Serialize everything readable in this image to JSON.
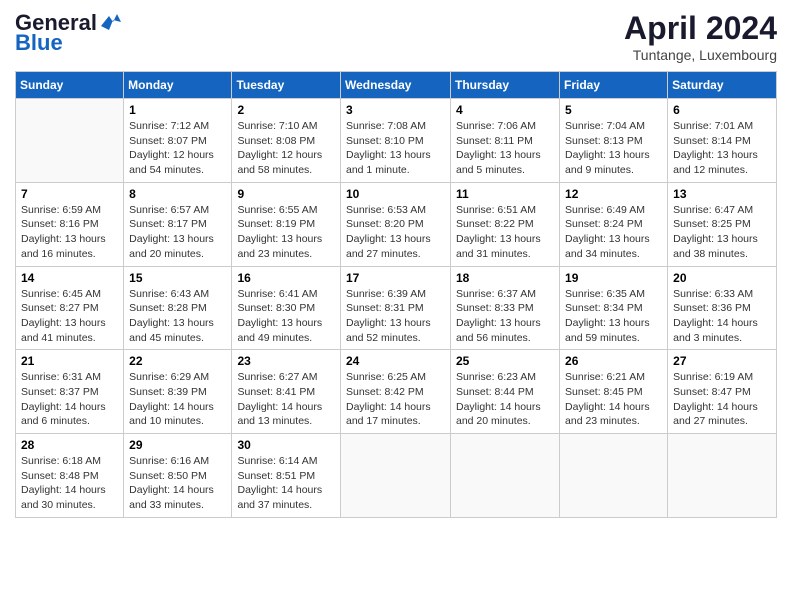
{
  "header": {
    "logo_general": "General",
    "logo_blue": "Blue",
    "month_title": "April 2024",
    "location": "Tuntange, Luxembourg"
  },
  "weekdays": [
    "Sunday",
    "Monday",
    "Tuesday",
    "Wednesday",
    "Thursday",
    "Friday",
    "Saturday"
  ],
  "weeks": [
    [
      {
        "day": "",
        "sunrise": "",
        "sunset": "",
        "daylight": ""
      },
      {
        "day": "1",
        "sunrise": "Sunrise: 7:12 AM",
        "sunset": "Sunset: 8:07 PM",
        "daylight": "Daylight: 12 hours and 54 minutes."
      },
      {
        "day": "2",
        "sunrise": "Sunrise: 7:10 AM",
        "sunset": "Sunset: 8:08 PM",
        "daylight": "Daylight: 12 hours and 58 minutes."
      },
      {
        "day": "3",
        "sunrise": "Sunrise: 7:08 AM",
        "sunset": "Sunset: 8:10 PM",
        "daylight": "Daylight: 13 hours and 1 minute."
      },
      {
        "day": "4",
        "sunrise": "Sunrise: 7:06 AM",
        "sunset": "Sunset: 8:11 PM",
        "daylight": "Daylight: 13 hours and 5 minutes."
      },
      {
        "day": "5",
        "sunrise": "Sunrise: 7:04 AM",
        "sunset": "Sunset: 8:13 PM",
        "daylight": "Daylight: 13 hours and 9 minutes."
      },
      {
        "day": "6",
        "sunrise": "Sunrise: 7:01 AM",
        "sunset": "Sunset: 8:14 PM",
        "daylight": "Daylight: 13 hours and 12 minutes."
      }
    ],
    [
      {
        "day": "7",
        "sunrise": "Sunrise: 6:59 AM",
        "sunset": "Sunset: 8:16 PM",
        "daylight": "Daylight: 13 hours and 16 minutes."
      },
      {
        "day": "8",
        "sunrise": "Sunrise: 6:57 AM",
        "sunset": "Sunset: 8:17 PM",
        "daylight": "Daylight: 13 hours and 20 minutes."
      },
      {
        "day": "9",
        "sunrise": "Sunrise: 6:55 AM",
        "sunset": "Sunset: 8:19 PM",
        "daylight": "Daylight: 13 hours and 23 minutes."
      },
      {
        "day": "10",
        "sunrise": "Sunrise: 6:53 AM",
        "sunset": "Sunset: 8:20 PM",
        "daylight": "Daylight: 13 hours and 27 minutes."
      },
      {
        "day": "11",
        "sunrise": "Sunrise: 6:51 AM",
        "sunset": "Sunset: 8:22 PM",
        "daylight": "Daylight: 13 hours and 31 minutes."
      },
      {
        "day": "12",
        "sunrise": "Sunrise: 6:49 AM",
        "sunset": "Sunset: 8:24 PM",
        "daylight": "Daylight: 13 hours and 34 minutes."
      },
      {
        "day": "13",
        "sunrise": "Sunrise: 6:47 AM",
        "sunset": "Sunset: 8:25 PM",
        "daylight": "Daylight: 13 hours and 38 minutes."
      }
    ],
    [
      {
        "day": "14",
        "sunrise": "Sunrise: 6:45 AM",
        "sunset": "Sunset: 8:27 PM",
        "daylight": "Daylight: 13 hours and 41 minutes."
      },
      {
        "day": "15",
        "sunrise": "Sunrise: 6:43 AM",
        "sunset": "Sunset: 8:28 PM",
        "daylight": "Daylight: 13 hours and 45 minutes."
      },
      {
        "day": "16",
        "sunrise": "Sunrise: 6:41 AM",
        "sunset": "Sunset: 8:30 PM",
        "daylight": "Daylight: 13 hours and 49 minutes."
      },
      {
        "day": "17",
        "sunrise": "Sunrise: 6:39 AM",
        "sunset": "Sunset: 8:31 PM",
        "daylight": "Daylight: 13 hours and 52 minutes."
      },
      {
        "day": "18",
        "sunrise": "Sunrise: 6:37 AM",
        "sunset": "Sunset: 8:33 PM",
        "daylight": "Daylight: 13 hours and 56 minutes."
      },
      {
        "day": "19",
        "sunrise": "Sunrise: 6:35 AM",
        "sunset": "Sunset: 8:34 PM",
        "daylight": "Daylight: 13 hours and 59 minutes."
      },
      {
        "day": "20",
        "sunrise": "Sunrise: 6:33 AM",
        "sunset": "Sunset: 8:36 PM",
        "daylight": "Daylight: 14 hours and 3 minutes."
      }
    ],
    [
      {
        "day": "21",
        "sunrise": "Sunrise: 6:31 AM",
        "sunset": "Sunset: 8:37 PM",
        "daylight": "Daylight: 14 hours and 6 minutes."
      },
      {
        "day": "22",
        "sunrise": "Sunrise: 6:29 AM",
        "sunset": "Sunset: 8:39 PM",
        "daylight": "Daylight: 14 hours and 10 minutes."
      },
      {
        "day": "23",
        "sunrise": "Sunrise: 6:27 AM",
        "sunset": "Sunset: 8:41 PM",
        "daylight": "Daylight: 14 hours and 13 minutes."
      },
      {
        "day": "24",
        "sunrise": "Sunrise: 6:25 AM",
        "sunset": "Sunset: 8:42 PM",
        "daylight": "Daylight: 14 hours and 17 minutes."
      },
      {
        "day": "25",
        "sunrise": "Sunrise: 6:23 AM",
        "sunset": "Sunset: 8:44 PM",
        "daylight": "Daylight: 14 hours and 20 minutes."
      },
      {
        "day": "26",
        "sunrise": "Sunrise: 6:21 AM",
        "sunset": "Sunset: 8:45 PM",
        "daylight": "Daylight: 14 hours and 23 minutes."
      },
      {
        "day": "27",
        "sunrise": "Sunrise: 6:19 AM",
        "sunset": "Sunset: 8:47 PM",
        "daylight": "Daylight: 14 hours and 27 minutes."
      }
    ],
    [
      {
        "day": "28",
        "sunrise": "Sunrise: 6:18 AM",
        "sunset": "Sunset: 8:48 PM",
        "daylight": "Daylight: 14 hours and 30 minutes."
      },
      {
        "day": "29",
        "sunrise": "Sunrise: 6:16 AM",
        "sunset": "Sunset: 8:50 PM",
        "daylight": "Daylight: 14 hours and 33 minutes."
      },
      {
        "day": "30",
        "sunrise": "Sunrise: 6:14 AM",
        "sunset": "Sunset: 8:51 PM",
        "daylight": "Daylight: 14 hours and 37 minutes."
      },
      {
        "day": "",
        "sunrise": "",
        "sunset": "",
        "daylight": ""
      },
      {
        "day": "",
        "sunrise": "",
        "sunset": "",
        "daylight": ""
      },
      {
        "day": "",
        "sunrise": "",
        "sunset": "",
        "daylight": ""
      },
      {
        "day": "",
        "sunrise": "",
        "sunset": "",
        "daylight": ""
      }
    ]
  ]
}
